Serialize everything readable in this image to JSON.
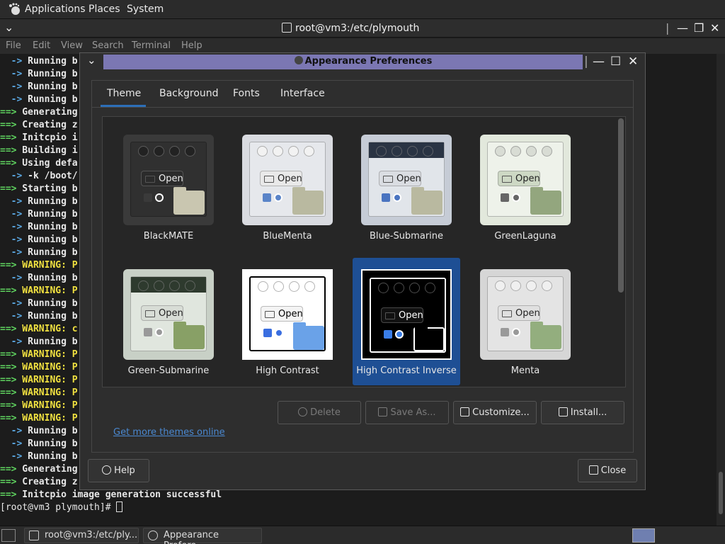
{
  "top_panel": {
    "menus": [
      "Applications",
      "Places",
      "System"
    ]
  },
  "terminal": {
    "title": "root@vm3:/etc/plymouth",
    "menus": [
      "File",
      "Edit",
      "View",
      "Search",
      "Terminal",
      "Help"
    ],
    "lines": [
      {
        "kind": "arrow",
        "prefix": "  ->",
        "text": " Running b"
      },
      {
        "kind": "arrow",
        "prefix": "  ->",
        "text": " Running b"
      },
      {
        "kind": "arrow",
        "prefix": "  ->",
        "text": " Running b"
      },
      {
        "kind": "arrow",
        "prefix": "  ->",
        "text": " Running b"
      },
      {
        "kind": "green",
        "prefix": "==>",
        "text": " Generating"
      },
      {
        "kind": "green",
        "prefix": "==>",
        "text": " Creating z"
      },
      {
        "kind": "green",
        "prefix": "==>",
        "text": " Initcpio i"
      },
      {
        "kind": "green",
        "prefix": "==>",
        "text": " Building i"
      },
      {
        "kind": "green",
        "prefix": "==>",
        "text": " Using defa"
      },
      {
        "kind": "arrow",
        "prefix": "  ->",
        "text": " -k /boot/"
      },
      {
        "kind": "green",
        "prefix": "==>",
        "text": " Starting b"
      },
      {
        "kind": "arrow",
        "prefix": "  ->",
        "text": " Running b"
      },
      {
        "kind": "arrow",
        "prefix": "  ->",
        "text": " Running b"
      },
      {
        "kind": "arrow",
        "prefix": "  ->",
        "text": " Running b"
      },
      {
        "kind": "arrow",
        "prefix": "  ->",
        "text": " Running b"
      },
      {
        "kind": "arrow",
        "prefix": "  ->",
        "text": " Running b"
      },
      {
        "kind": "warn",
        "prefix": "==>",
        "text": " WARNING: P"
      },
      {
        "kind": "arrow",
        "prefix": "  ->",
        "text": " Running b"
      },
      {
        "kind": "warn",
        "prefix": "==>",
        "text": " WARNING: P"
      },
      {
        "kind": "arrow",
        "prefix": "  ->",
        "text": " Running b"
      },
      {
        "kind": "arrow",
        "prefix": "  ->",
        "text": " Running b"
      },
      {
        "kind": "warn",
        "prefix": "==>",
        "text": " WARNING: c"
      },
      {
        "kind": "arrow",
        "prefix": "  ->",
        "text": " Running b"
      },
      {
        "kind": "warn",
        "prefix": "==>",
        "text": " WARNING: P"
      },
      {
        "kind": "warn",
        "prefix": "==>",
        "text": " WARNING: P"
      },
      {
        "kind": "warn",
        "prefix": "==>",
        "text": " WARNING: P"
      },
      {
        "kind": "warn",
        "prefix": "==>",
        "text": " WARNING: P"
      },
      {
        "kind": "warn",
        "prefix": "==>",
        "text": " WARNING: P"
      },
      {
        "kind": "warn",
        "prefix": "==>",
        "text": " WARNING: P"
      },
      {
        "kind": "arrow",
        "prefix": "  ->",
        "text": " Running b"
      },
      {
        "kind": "arrow",
        "prefix": "  ->",
        "text": " Running b"
      },
      {
        "kind": "arrow",
        "prefix": "  ->",
        "text": " Running b"
      },
      {
        "kind": "green",
        "prefix": "==>",
        "text": " Generating"
      },
      {
        "kind": "green",
        "prefix": "==>",
        "text": " Creating z"
      },
      {
        "kind": "green",
        "prefix": "==>",
        "text": " Initcpio image generation successful"
      }
    ],
    "prompt": "[root@vm3 plymouth]# "
  },
  "dialog": {
    "title": "Appearance Preferences",
    "tabs": [
      "Theme",
      "Background",
      "Fonts",
      "Interface"
    ],
    "active_tab": "Theme",
    "themes": [
      {
        "name": "BlackMATE",
        "style": "black",
        "open_label": "Open"
      },
      {
        "name": "BlueMenta",
        "style": "bluementa",
        "open_label": "Open"
      },
      {
        "name": "Blue-Submarine",
        "style": "bluesub",
        "open_label": "Open"
      },
      {
        "name": "GreenLaguna",
        "style": "greenlaguna",
        "open_label": "Open"
      },
      {
        "name": "Green-Submarine",
        "style": "greensub",
        "open_label": "Open"
      },
      {
        "name": "High Contrast",
        "style": "hc",
        "open_label": "Open"
      },
      {
        "name": "High Contrast Inverse",
        "style": "hci",
        "open_label": "Open"
      },
      {
        "name": "Menta",
        "style": "menta",
        "open_label": "Open"
      }
    ],
    "selected_theme": "High Contrast Inverse",
    "buttons": {
      "delete": "Delete",
      "save_as": "Save As...",
      "customize": "Customize...",
      "install": "Install..."
    },
    "link": "Get more themes online",
    "help": "Help",
    "close": "Close"
  },
  "taskbar": {
    "tasks": [
      "root@vm3:/etc/ply...",
      "Appearance Prefere..."
    ]
  },
  "colors": {
    "title_accent": "#7b77b3",
    "selection": "#1e4f94",
    "link": "#4a88d0"
  }
}
